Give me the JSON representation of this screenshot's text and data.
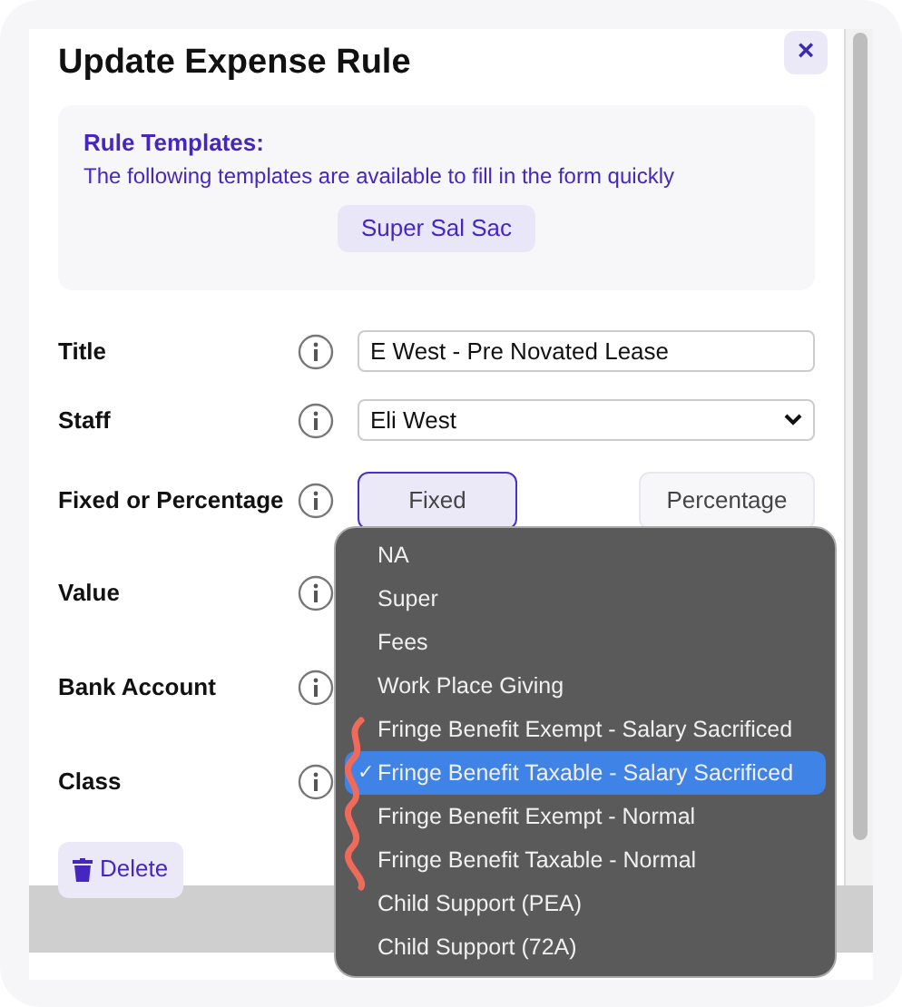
{
  "dialog": {
    "title": "Update Expense Rule",
    "close": "×"
  },
  "templates": {
    "heading": "Rule Templates:",
    "description": "The following templates are available to fill in the form quickly",
    "buttons": [
      "Super Sal Sac"
    ]
  },
  "fields": [
    {
      "label": "Title",
      "kind": "text",
      "value": "E West - Pre Novated Lease"
    },
    {
      "label": "Staff",
      "kind": "select",
      "value": "Eli West"
    },
    {
      "label": "Fixed or Percentage",
      "kind": "toggle",
      "options": [
        {
          "label": "Fixed",
          "selected": true
        },
        {
          "label": "Percentage",
          "selected": false
        }
      ]
    },
    {
      "label": "Value",
      "kind": "covered"
    },
    {
      "label": "Bank Account",
      "kind": "covered"
    },
    {
      "label": "Class",
      "kind": "covered"
    }
  ],
  "delete_button": "Delete",
  "dropdown": {
    "options": [
      {
        "label": "NA",
        "selected": false
      },
      {
        "label": "Super",
        "selected": false
      },
      {
        "label": "Fees",
        "selected": false
      },
      {
        "label": "Work Place Giving",
        "selected": false
      },
      {
        "label": "Fringe Benefit Exempt - Salary Sacrificed",
        "selected": false
      },
      {
        "label": "Fringe Benefit Taxable - Salary Sacrificed",
        "selected": true
      },
      {
        "label": "Fringe Benefit Exempt - Normal",
        "selected": false
      },
      {
        "label": "Fringe Benefit Taxable - Normal",
        "selected": false
      },
      {
        "label": "Child Support (PEA)",
        "selected": false
      },
      {
        "label": "Child Support (72A)",
        "selected": false
      }
    ],
    "check": "✓"
  }
}
